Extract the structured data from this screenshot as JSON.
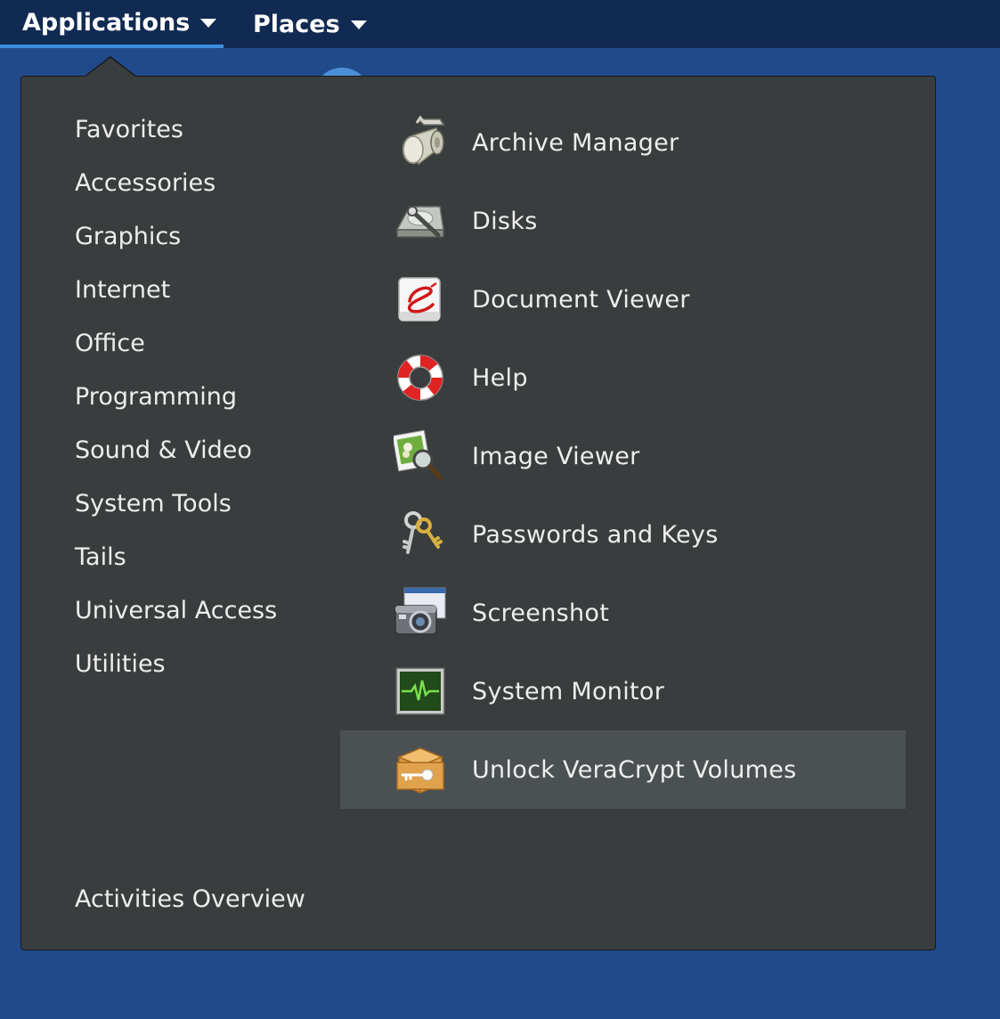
{
  "topbar": {
    "applications_label": "Applications",
    "places_label": "Places"
  },
  "categories": [
    "Favorites",
    "Accessories",
    "Graphics",
    "Internet",
    "Office",
    "Programming",
    "Sound & Video",
    "System Tools",
    "Tails",
    "Universal Access",
    "Utilities"
  ],
  "activities_label": "Activities Overview",
  "apps": [
    {
      "label": "Archive Manager",
      "icon": "archive-manager-icon"
    },
    {
      "label": "Disks",
      "icon": "disks-icon"
    },
    {
      "label": "Document Viewer",
      "icon": "document-viewer-icon"
    },
    {
      "label": "Help",
      "icon": "help-lifebuoy-icon"
    },
    {
      "label": "Image Viewer",
      "icon": "image-viewer-icon"
    },
    {
      "label": "Passwords and Keys",
      "icon": "keys-icon"
    },
    {
      "label": "Screenshot",
      "icon": "camera-icon"
    },
    {
      "label": "System Monitor",
      "icon": "system-monitor-icon"
    },
    {
      "label": "Unlock VeraCrypt Volumes",
      "icon": "veracrypt-box-icon"
    }
  ],
  "colors": {
    "desktop": "#214a8a",
    "topbar": "#112a52",
    "popup": "#393d3e",
    "hover": "#4b5052",
    "accent": "#3d8ee0"
  }
}
